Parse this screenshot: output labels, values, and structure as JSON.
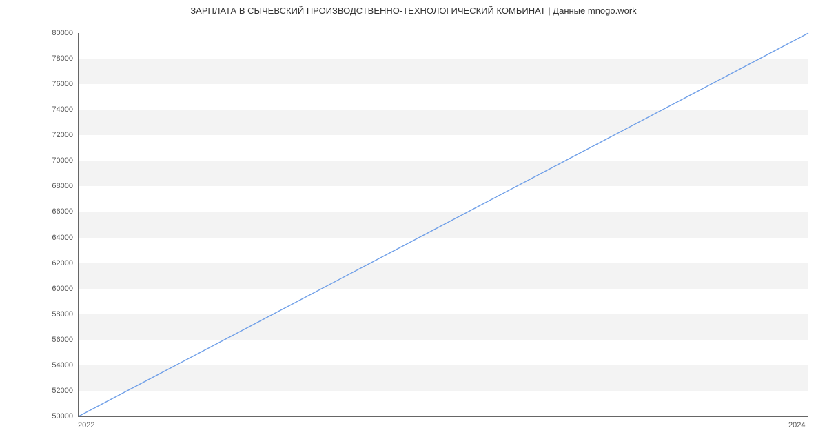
{
  "chart_data": {
    "type": "line",
    "title": "ЗАРПЛАТА В  СЫЧЕВСКИЙ ПРОИЗВОДСТВЕННО-ТЕХНОЛОГИЧЕСКИЙ КОМБИНАТ | Данные mnogo.work",
    "xlabel": "",
    "ylabel": "",
    "x": [
      2022,
      2024
    ],
    "values": [
      50000,
      80000
    ],
    "x_ticks": [
      2022,
      2024
    ],
    "y_ticks": [
      50000,
      52000,
      54000,
      56000,
      58000,
      60000,
      62000,
      64000,
      66000,
      68000,
      70000,
      72000,
      74000,
      76000,
      78000,
      80000
    ],
    "xlim": [
      2022,
      2024
    ],
    "ylim": [
      50000,
      80000
    ],
    "line_color": "#6f9fe8",
    "band_color": "#f3f3f3",
    "grid": false
  }
}
